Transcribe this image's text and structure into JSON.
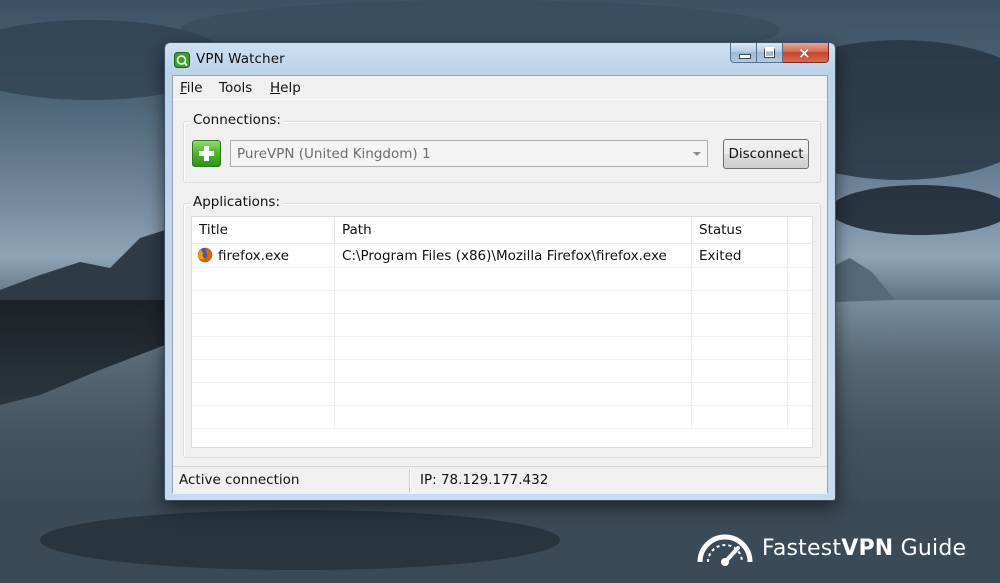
{
  "window": {
    "title": "VPN Watcher",
    "caption_buttons": {
      "minimize": "minimize-icon",
      "maximize": "maximize-icon",
      "close": "×"
    }
  },
  "menu": [
    {
      "first": "F",
      "rest": "ile",
      "underline_first": true
    },
    {
      "first": "",
      "rest": "Tools",
      "underline_first": false
    },
    {
      "first": "H",
      "rest": "elp",
      "underline_first": true
    }
  ],
  "connections": {
    "label": "Connections:",
    "add_icon": "plus-icon",
    "selected": "PureVPN (United Kingdom) 1",
    "disconnect_label": "Disconnect"
  },
  "applications": {
    "label": "Applications:",
    "columns": [
      "Title",
      "Path",
      "Status"
    ],
    "rows": [
      {
        "icon": "firefox-icon",
        "title": "firefox.exe",
        "path": "C:\\Program Files (x86)\\Mozilla Firefox\\firefox.exe",
        "status": "Exited"
      }
    ]
  },
  "statusbar": {
    "left": "Active connection",
    "right": "IP: 78.129.177.432"
  },
  "watermark": {
    "word1": "Fastest",
    "word2": "VPN",
    "word3": "Guide",
    "icon": "speedometer-icon"
  },
  "colors": {
    "accent_green": "#4fb52b",
    "close_red": "#c4452a",
    "titlebar": "#bdd3ea"
  }
}
